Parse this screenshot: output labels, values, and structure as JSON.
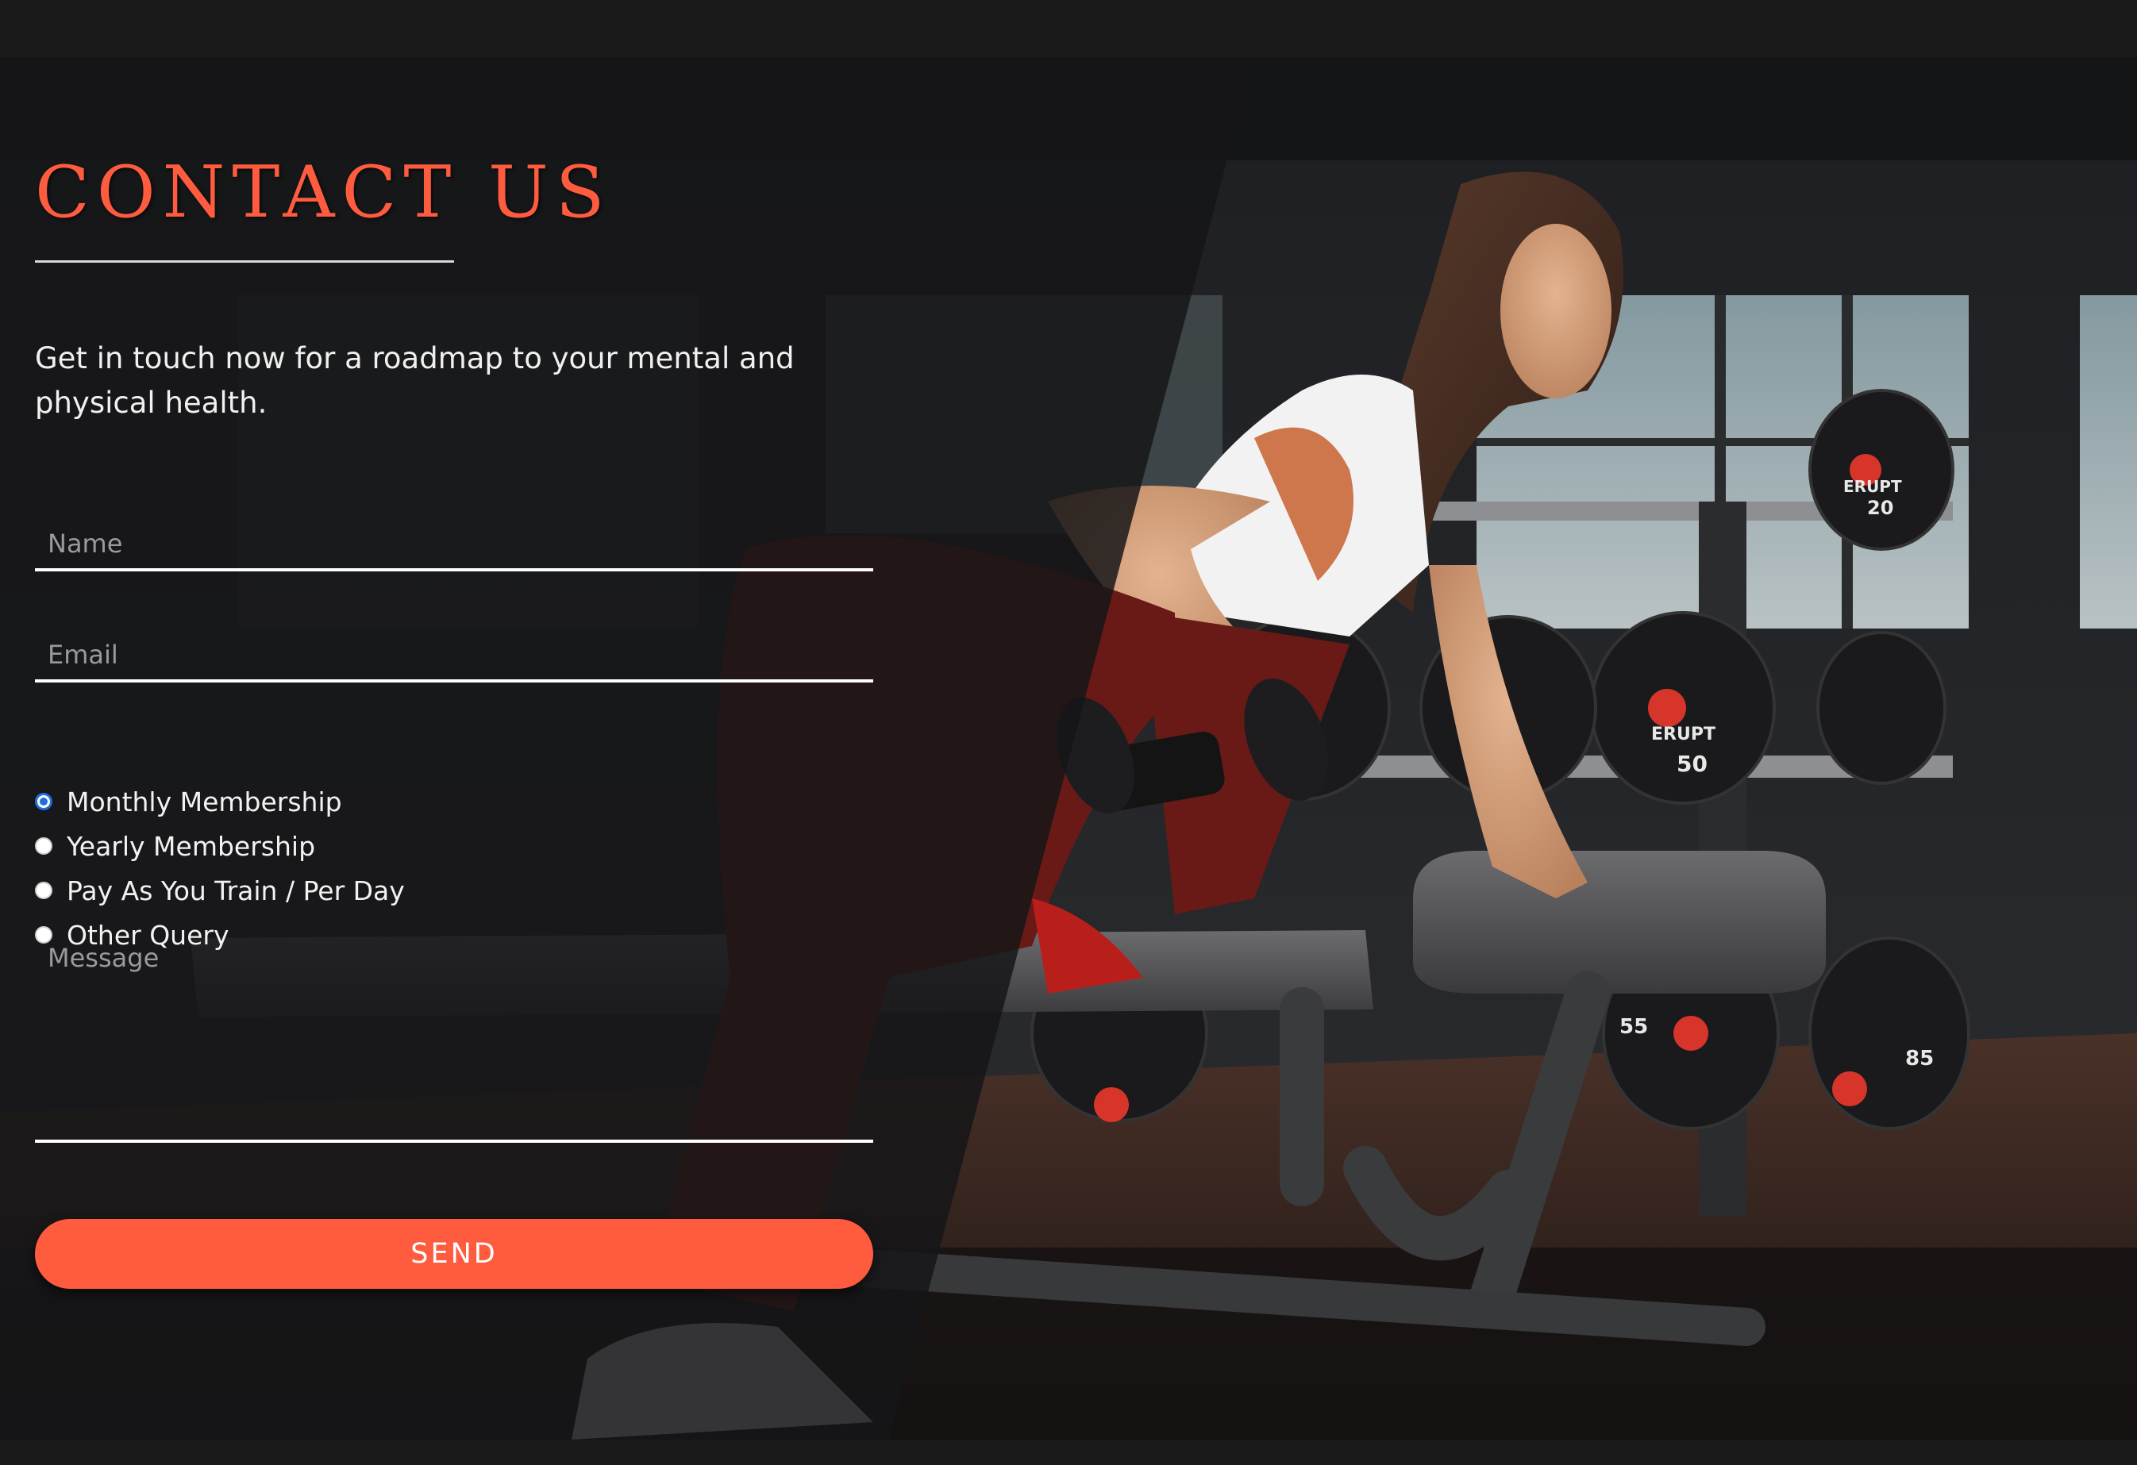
{
  "page": {
    "title": "CONTACT US",
    "intro": "Get in touch now for a roadmap to your mental and physical health."
  },
  "form": {
    "name_placeholder": "Name",
    "email_placeholder": "Email",
    "message_placeholder": "Message",
    "membership_options": [
      {
        "label": "Monthly Membership",
        "checked": true
      },
      {
        "label": "Yearly Membership",
        "checked": false
      },
      {
        "label": "Pay As You Train / Per Day",
        "checked": false
      },
      {
        "label": "Other Query",
        "checked": false
      }
    ],
    "send_label": "SEND"
  },
  "background": {
    "subject": "woman doing a one-arm dumbbell row on a gym bench in front of a dumbbell rack",
    "dumbbell_labels": [
      "ERUPT",
      "20",
      "50",
      "55",
      "85"
    ]
  },
  "colors": {
    "accent": "#ff5c3f",
    "radio_selected": "#1e6fe0",
    "page_background": "#181818"
  }
}
